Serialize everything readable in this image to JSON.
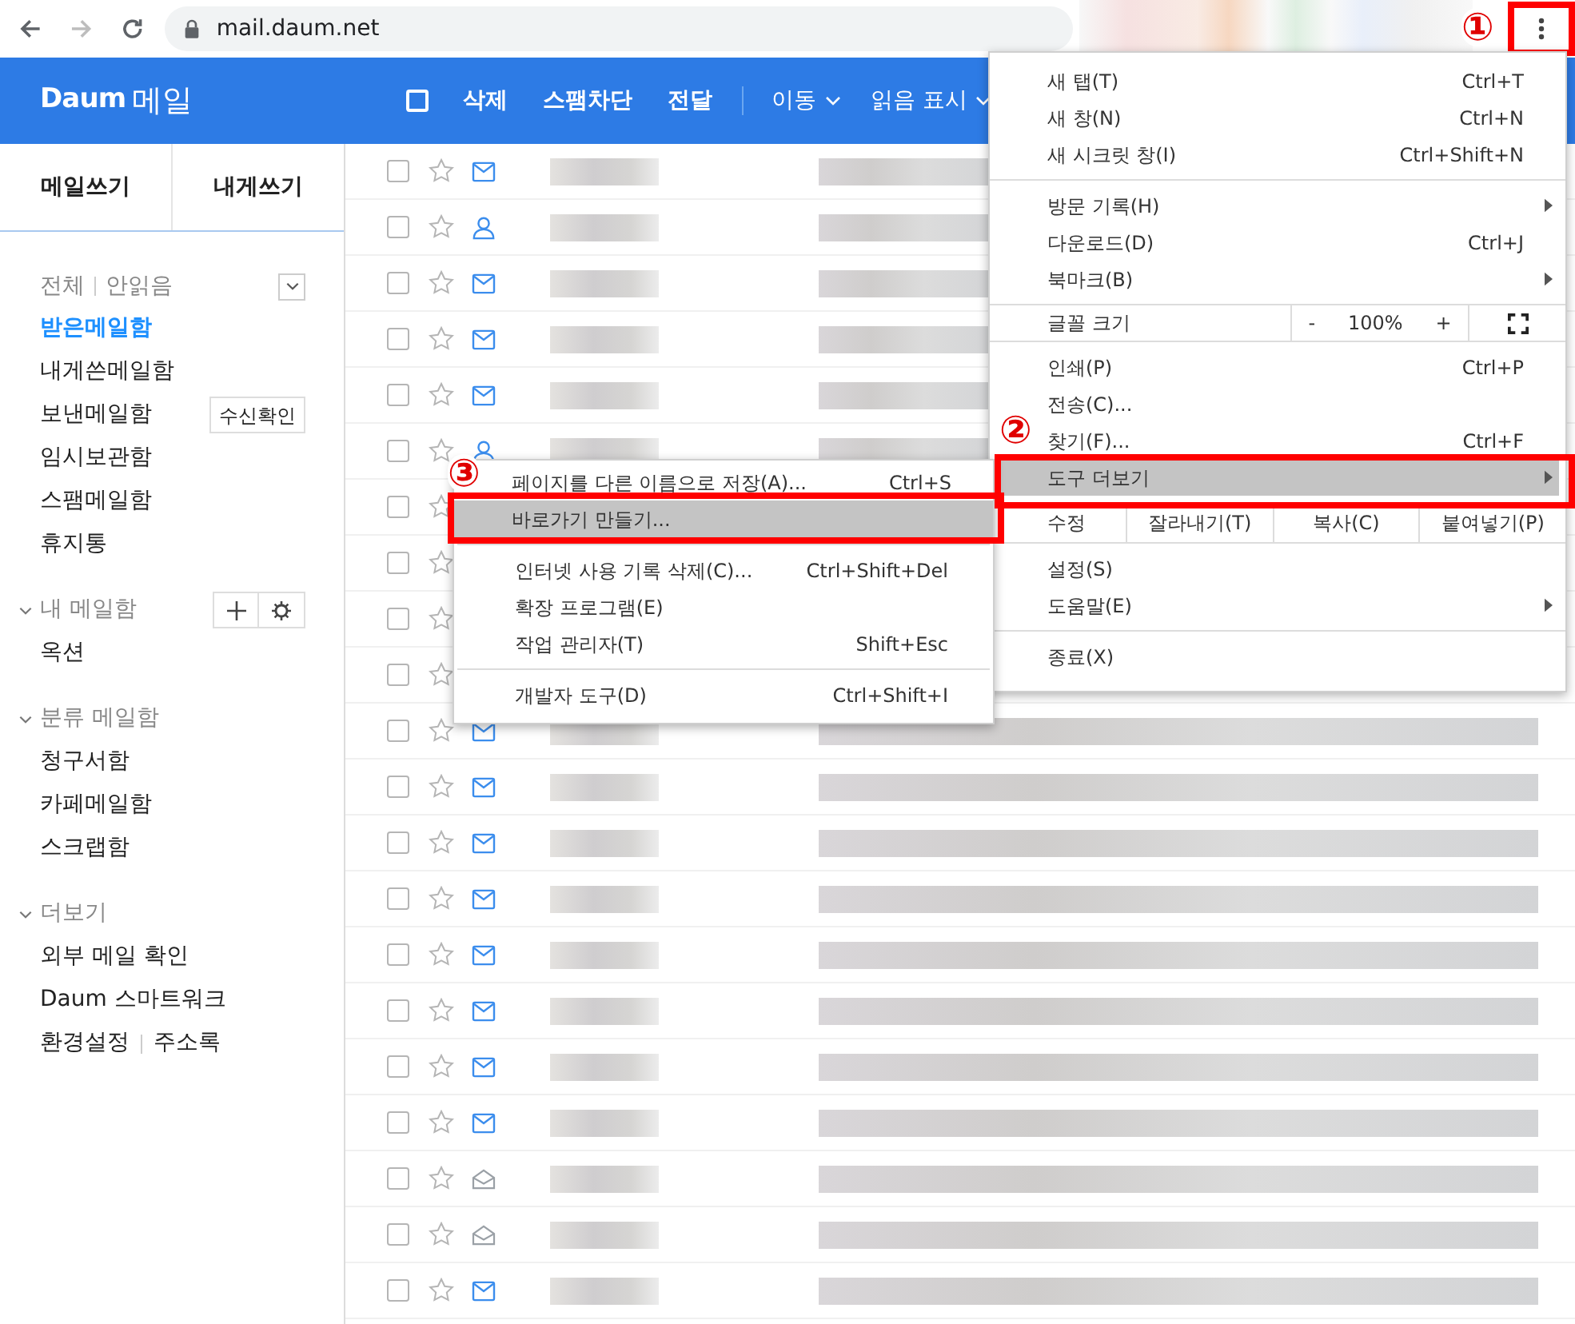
{
  "browser": {
    "back_disabled": false,
    "forward_disabled": true,
    "url": "mail.daum.net"
  },
  "mail_header": {
    "logo": "Daum",
    "title": "메일",
    "select_all_checked": false,
    "actions": [
      "삭제",
      "스팸차단",
      "전달"
    ],
    "dropdowns": [
      "이동",
      "읽음 표시"
    ]
  },
  "sidebar": {
    "compose": [
      "메일쓰기",
      "내게쓰기"
    ],
    "filters": [
      "전체",
      "안읽음"
    ],
    "folders": [
      {
        "label": "받은메일함",
        "selected": true
      },
      {
        "label": "내게쓴메일함",
        "selected": false
      },
      {
        "label": "보낸메일함",
        "selected": false,
        "action": "수신확인"
      },
      {
        "label": "임시보관함",
        "selected": false
      },
      {
        "label": "스팸메일함",
        "selected": false
      },
      {
        "label": "휴지통",
        "selected": false
      }
    ],
    "sections": [
      {
        "title": "내 메일함",
        "expanded": true,
        "tools": true,
        "items": [
          "옥션"
        ]
      },
      {
        "title": "분류 메일함",
        "expanded": true,
        "items": [
          "청구서함",
          "카페메일함",
          "스크랩함"
        ]
      },
      {
        "title": "더보기",
        "expanded": true,
        "items": [
          "외부 메일 확인",
          "Daum 스마트워크"
        ]
      }
    ],
    "footer_links": [
      "환경설정",
      "주소록"
    ]
  },
  "mail_rows": [
    {
      "kind": "mail",
      "checked": false
    },
    {
      "kind": "contact",
      "checked": false
    },
    {
      "kind": "mail",
      "checked": false
    },
    {
      "kind": "mail",
      "checked": false
    },
    {
      "kind": "mail",
      "checked": false
    },
    {
      "kind": "contact",
      "checked": false
    },
    {
      "kind": "covered",
      "checked": false
    },
    {
      "kind": "covered",
      "checked": false
    },
    {
      "kind": "covered",
      "checked": false
    },
    {
      "kind": "covered",
      "checked": false
    },
    {
      "kind": "mail",
      "checked": false
    },
    {
      "kind": "mail",
      "checked": false
    },
    {
      "kind": "mail",
      "checked": false
    },
    {
      "kind": "mail",
      "checked": false
    },
    {
      "kind": "mail",
      "checked": false
    },
    {
      "kind": "mail",
      "checked": false
    },
    {
      "kind": "mail",
      "checked": false
    },
    {
      "kind": "mail",
      "checked": false
    },
    {
      "kind": "read",
      "checked": false
    },
    {
      "kind": "read",
      "checked": false
    },
    {
      "kind": "mail",
      "checked": false
    }
  ],
  "chrome_menu": {
    "groups": [
      [
        {
          "kind": "item",
          "label": "새 탭(T)",
          "shortcut": "Ctrl+T",
          "selected": false
        },
        {
          "kind": "item",
          "label": "새 창(N)",
          "shortcut": "Ctrl+N",
          "selected": false
        },
        {
          "kind": "item",
          "label": "새 시크릿 창(I)",
          "shortcut": "Ctrl+Shift+N",
          "selected": false
        }
      ],
      [
        {
          "kind": "item",
          "label": "방문 기록(H)",
          "submenu": true,
          "selected": false
        },
        {
          "kind": "item",
          "label": "다운로드(D)",
          "shortcut": "Ctrl+J",
          "selected": false
        },
        {
          "kind": "item",
          "label": "북마크(B)",
          "submenu": true,
          "selected": false
        }
      ],
      [
        {
          "kind": "zoom",
          "label": "글꼴 크기",
          "minus": "-",
          "value": "100%",
          "plus": "+"
        }
      ],
      [
        {
          "kind": "item",
          "label": "인쇄(P)",
          "shortcut": "Ctrl+P",
          "selected": false
        },
        {
          "kind": "item",
          "label": "전송(C)...",
          "selected": false
        },
        {
          "kind": "item",
          "label": "찾기(F)...",
          "shortcut": "Ctrl+F",
          "selected": false
        },
        {
          "kind": "item",
          "label": "도구 더보기",
          "submenu": true,
          "selected": true
        }
      ],
      [
        {
          "kind": "edit",
          "label": "수정",
          "buttons": [
            "잘라내기(T)",
            "복사(C)",
            "붙여넣기(P)"
          ]
        }
      ],
      [
        {
          "kind": "item",
          "label": "설정(S)",
          "selected": false
        },
        {
          "kind": "item",
          "label": "도움말(E)",
          "submenu": true,
          "selected": false
        }
      ],
      [
        {
          "kind": "item",
          "label": "종료(X)",
          "selected": false
        }
      ]
    ]
  },
  "tools_submenu": {
    "groups": [
      [
        {
          "label": "페이지를 다른 이름으로 저장(A)...",
          "shortcut": "Ctrl+S",
          "selected": false
        },
        {
          "label": "바로가기 만들기...",
          "selected": true
        }
      ],
      [
        {
          "label": "인터넷 사용 기록 삭제(C)...",
          "shortcut": "Ctrl+Shift+Del",
          "selected": false
        },
        {
          "label": "확장 프로그램(E)",
          "selected": false
        },
        {
          "label": "작업 관리자(T)",
          "shortcut": "Shift+Esc",
          "selected": false
        }
      ],
      [
        {
          "label": "개발자 도구(D)",
          "shortcut": "Ctrl+Shift+I",
          "selected": false
        }
      ]
    ]
  },
  "annotations": [
    "①",
    "②",
    "③"
  ]
}
